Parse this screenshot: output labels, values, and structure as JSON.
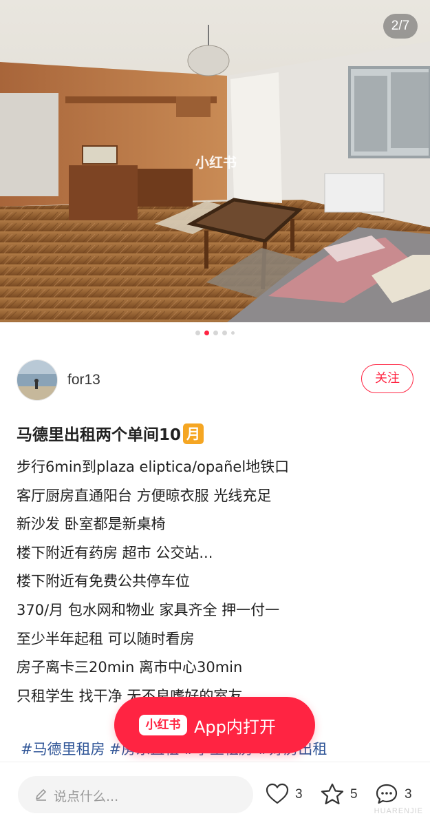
{
  "gallery": {
    "counter": "2/7",
    "watermark": "小红书",
    "dots": 5,
    "active_dot": 1
  },
  "author": {
    "name": "for13",
    "follow_label": "关注"
  },
  "post": {
    "title": "马德里出租两个单间10",
    "title_badge": "月",
    "lines": [
      "步行6min到plaza eliptica/opañel地铁口",
      "客厅厨房直通阳台 方便晾衣服 光线充足",
      "新沙发 卧室都是新桌椅",
      "楼下附近有药房 超市 公交站...",
      "楼下附近有免费公共停车位",
      "370/月 包水网和物业 家具齐全 押一付一",
      "至少半年起租 可以随时看房",
      "房子离卡三20min 离市中心30min",
      "只租学生 找干净 无不良嗜好的室友"
    ],
    "tags": [
      "#马德里租房",
      "#房东直租",
      "#学生租房",
      "#好房出租"
    ]
  },
  "open_app": {
    "logo": "小红书",
    "label": "App内打开"
  },
  "bottom_bar": {
    "comment_placeholder": "说点什么...",
    "like_count": "3",
    "collect_count": "5",
    "comment_count": "3"
  },
  "site_mark": "HUARENJIE",
  "colors": {
    "brand": "#ff2442",
    "tag": "#2f5597",
    "badge": "#f5a623"
  }
}
